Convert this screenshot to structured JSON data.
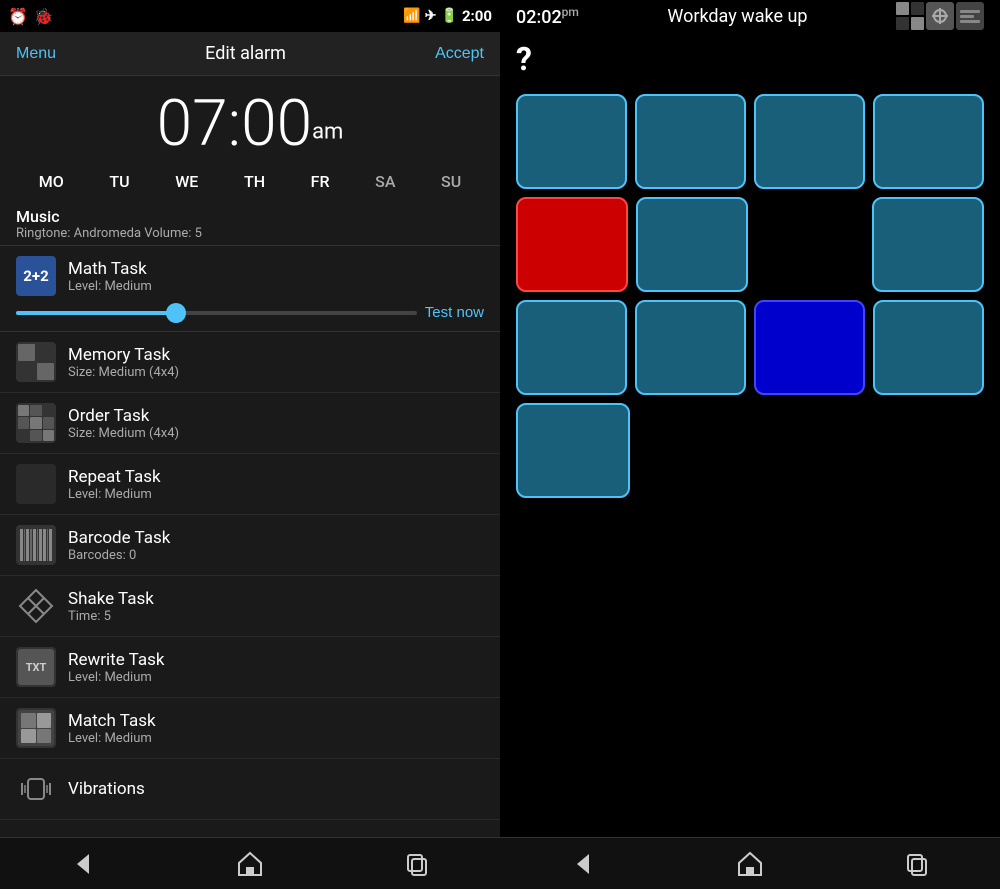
{
  "left": {
    "statusBar": {
      "time": "2:00",
      "icons": [
        "alarm",
        "bug",
        "wifi",
        "plane",
        "battery"
      ]
    },
    "topNav": {
      "menu": "Menu",
      "title": "Edit alarm",
      "accept": "Accept"
    },
    "timeDisplay": {
      "time": "07:00",
      "ampm": "am"
    },
    "days": [
      {
        "label": "MO",
        "active": true
      },
      {
        "label": "TU",
        "active": true
      },
      {
        "label": "WE",
        "active": true
      },
      {
        "label": "TH",
        "active": true
      },
      {
        "label": "FR",
        "active": true
      },
      {
        "label": "SA",
        "active": false
      },
      {
        "label": "SU",
        "active": false
      }
    ],
    "music": {
      "title": "Music",
      "subtitle": "Ringtone: Andromeda  Volume: 5"
    },
    "mathTask": {
      "name": "Math Task",
      "detail": "Level: Medium",
      "testNow": "Test now"
    },
    "tasks": [
      {
        "name": "Memory Task",
        "detail": "Size: Medium (4x4)",
        "iconType": "memory"
      },
      {
        "name": "Order Task",
        "detail": "Size: Medium (4x4)",
        "iconType": "order"
      },
      {
        "name": "Repeat Task",
        "detail": "Level: Medium",
        "iconType": "repeat"
      },
      {
        "name": "Barcode Task",
        "detail": "Barcodes: 0",
        "iconType": "barcode"
      },
      {
        "name": "Shake Task",
        "detail": "Time: 5",
        "iconType": "shake"
      },
      {
        "name": "Rewrite Task",
        "detail": "Level: Medium",
        "iconType": "rewrite"
      },
      {
        "name": "Match Task",
        "detail": "Level: Medium",
        "iconType": "match"
      },
      {
        "name": "Vibrations",
        "detail": "",
        "iconType": "vibration"
      }
    ],
    "bottomNav": [
      "back",
      "home",
      "recent"
    ]
  },
  "right": {
    "statusBar": {
      "time": "02:02",
      "ampm": "pm",
      "title": "Workday wake up"
    },
    "questionMark": "?",
    "grid": {
      "rows": [
        [
          "teal",
          "teal",
          "teal",
          "teal"
        ],
        [
          "red",
          "teal",
          "empty",
          "teal"
        ],
        [
          "teal",
          "teal",
          "blue",
          "teal"
        ],
        [
          "teal",
          "empty",
          "empty",
          "empty"
        ]
      ]
    },
    "bottomNav": [
      "back",
      "home",
      "recent"
    ]
  }
}
